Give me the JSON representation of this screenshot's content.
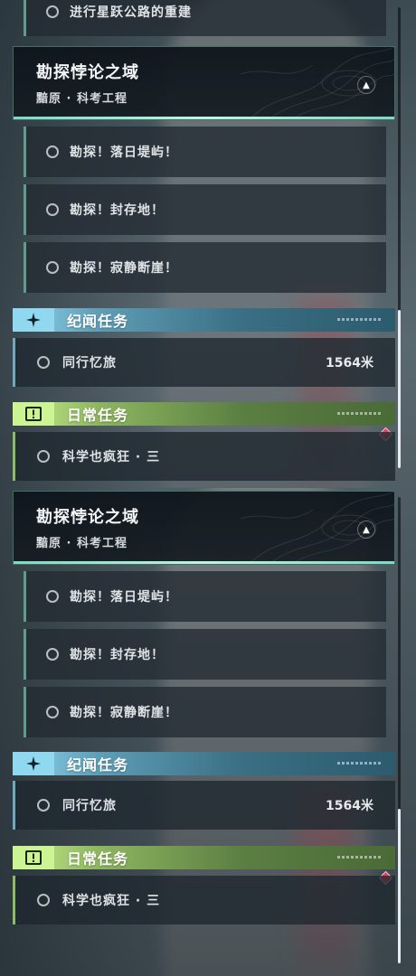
{
  "panels": [
    {
      "top_partial_task": {
        "label": "进行星跃公路的重建"
      },
      "quest": {
        "title": "勘探悖论之域",
        "subtitle": "黯原 · 科考工程"
      },
      "subtasks": [
        {
          "label": "勘探！落日堤屿！"
        },
        {
          "label": "勘探！封存地！"
        },
        {
          "label": "勘探！寂静断崖！"
        }
      ],
      "story_section": {
        "label": "纪闻任务"
      },
      "story_task": {
        "label": "同行忆旅",
        "distance": "1564米"
      },
      "daily_section": {
        "label": "日常任务"
      },
      "daily_task": {
        "label": "科学也疯狂 · 三"
      },
      "scrollbar": {
        "position_fraction": 0.66
      }
    },
    {
      "quest": {
        "title": "勘探悖论之域",
        "subtitle": "黯原 · 科考工程"
      },
      "subtasks": [
        {
          "label": "勘探！落日堤屿！"
        },
        {
          "label": "勘探！封存地！"
        },
        {
          "label": "勘探！寂静断崖！"
        }
      ],
      "story_section": {
        "label": "纪闻任务"
      },
      "story_task": {
        "label": "同行忆旅",
        "distance": "1564米"
      },
      "daily_section": {
        "label": "日常任务"
      },
      "daily_task": {
        "label": "科学也疯狂 · 三"
      },
      "scrollbar": {
        "position_fraction": 0.66
      }
    }
  ],
  "icons": {
    "collapse": "chevron-up-icon",
    "story": "sparkle-icon",
    "daily": "exclamation-icon",
    "pending": "ring-icon",
    "alert": "red-diamond-icon"
  },
  "colors": {
    "story_accent": "#8fd8f0",
    "daily_accent": "#cdf493",
    "quest_border": "#7fd9c2",
    "alert": "#d9485a"
  }
}
